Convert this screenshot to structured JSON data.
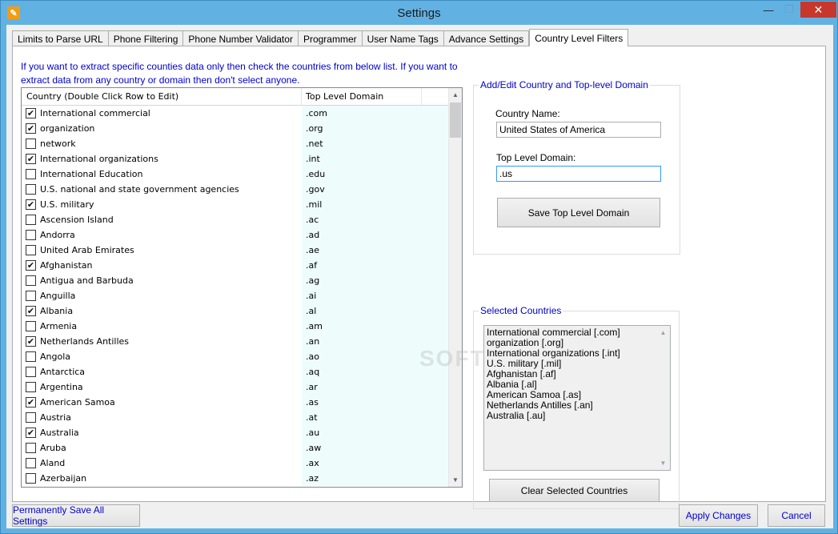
{
  "window": {
    "title": "Settings",
    "icon": "wrench-icon",
    "controls": {
      "minimize": "—",
      "maximize": "❐",
      "close": "✕"
    }
  },
  "tabs": [
    {
      "label": "Limits to Parse URL"
    },
    {
      "label": "Phone Filtering"
    },
    {
      "label": "Phone Number Validator"
    },
    {
      "label": "Programmer"
    },
    {
      "label": "User Name Tags"
    },
    {
      "label": "Advance Settings"
    },
    {
      "label": "Country Level Filters",
      "active": true
    }
  ],
  "info_text": "If you want to extract specific counties data only then check the countries from below list. If you want to extract data from any country or domain then don't select anyone.",
  "grid": {
    "columns": [
      "Country (Double Click Row to Edit)",
      "Top Level Domain"
    ],
    "rows": [
      {
        "country": "International commercial",
        "tld": ".com",
        "checked": true
      },
      {
        "country": "organization",
        "tld": ".org",
        "checked": true
      },
      {
        "country": "network",
        "tld": ".net",
        "checked": false
      },
      {
        "country": "International organizations",
        "tld": ".int",
        "checked": true
      },
      {
        "country": "International Education",
        "tld": ".edu",
        "checked": false
      },
      {
        "country": "U.S. national and state government agencies",
        "tld": ".gov",
        "checked": false
      },
      {
        "country": "U.S. military",
        "tld": ".mil",
        "checked": true
      },
      {
        "country": "Ascension Island",
        "tld": ".ac",
        "checked": false
      },
      {
        "country": "Andorra",
        "tld": ".ad",
        "checked": false
      },
      {
        "country": "United Arab Emirates",
        "tld": ".ae",
        "checked": false
      },
      {
        "country": "Afghanistan",
        "tld": ".af",
        "checked": true
      },
      {
        "country": "Antigua and Barbuda",
        "tld": ".ag",
        "checked": false
      },
      {
        "country": "Anguilla",
        "tld": ".ai",
        "checked": false
      },
      {
        "country": "Albania",
        "tld": ".al",
        "checked": true
      },
      {
        "country": "Armenia",
        "tld": ".am",
        "checked": false
      },
      {
        "country": "Netherlands Antilles",
        "tld": ".an",
        "checked": true
      },
      {
        "country": "Angola",
        "tld": ".ao",
        "checked": false
      },
      {
        "country": "Antarctica",
        "tld": ".aq",
        "checked": false
      },
      {
        "country": "Argentina",
        "tld": ".ar",
        "checked": false
      },
      {
        "country": "American Samoa",
        "tld": ".as",
        "checked": true
      },
      {
        "country": "Austria",
        "tld": ".at",
        "checked": false
      },
      {
        "country": "Australia",
        "tld": ".au",
        "checked": true
      },
      {
        "country": "Aruba",
        "tld": ".aw",
        "checked": false
      },
      {
        "country": "Aland",
        "tld": ".ax",
        "checked": false
      },
      {
        "country": "Azerbaijan",
        "tld": ".az",
        "checked": false
      }
    ]
  },
  "edit_group": {
    "title": "Add/Edit Country and Top-level Domain",
    "country_label": "Country Name:",
    "country_value": "United States of America",
    "tld_label": "Top Level Domain:",
    "tld_value": ".us",
    "save_button": "Save Top Level Domain"
  },
  "selected_group": {
    "title": "Selected Countries",
    "items": [
      "International commercial [.com]",
      "organization [.org]",
      "International organizations [.int]",
      "U.S. military [.mil]",
      "Afghanistan [.af]",
      "Albania [.al]",
      "American Samoa [.as]",
      "Netherlands Antilles [.an]",
      "Australia [.au]"
    ],
    "clear_button": "Clear Selected Countries"
  },
  "footer": {
    "permanent_save": "Permanently Save All Settings",
    "apply": "Apply Changes",
    "cancel": "Cancel"
  },
  "watermark": "SOFT"
}
